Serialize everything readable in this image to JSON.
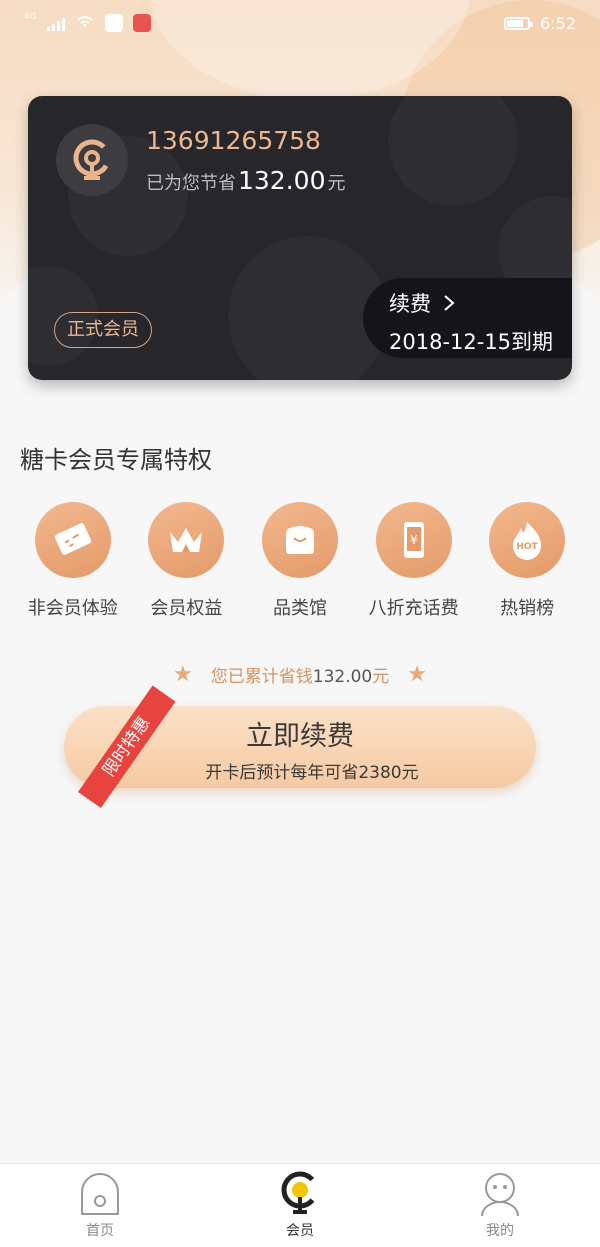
{
  "status_bar": {
    "network": "4G",
    "time": "6:52",
    "notification_icons": [
      "sina-weibo-icon",
      "red-app-icon"
    ]
  },
  "member_card": {
    "phone": "13691265758",
    "saved_prefix": "已为您节省",
    "saved_amount": "132.00",
    "saved_unit": "元",
    "member_badge": "正式会员",
    "renew_label": "续费",
    "expiry": "2018-12-15到期"
  },
  "privileges": {
    "title": "糖卡会员专属特权",
    "items": [
      {
        "label": "非会员体验",
        "icon": "ticket-icon"
      },
      {
        "label": "会员权益",
        "icon": "crown-icon"
      },
      {
        "label": "品类馆",
        "icon": "shopping-bag-icon"
      },
      {
        "label": "八折充话费",
        "icon": "phone-recharge-icon"
      },
      {
        "label": "热销榜",
        "icon": "hot-flame-icon"
      }
    ]
  },
  "accumulated": {
    "text": "您已累计省钱",
    "amount": "132.00",
    "unit": "元"
  },
  "renew_button": {
    "title": "立即续费",
    "subtitle": "开卡后预计每年可省2380元",
    "ribbon": "限时特惠"
  },
  "bottom_nav": {
    "items": [
      {
        "label": "首页",
        "icon": "home-icon",
        "active": false
      },
      {
        "label": "会员",
        "icon": "member-icon",
        "active": true
      },
      {
        "label": "我的",
        "icon": "profile-icon",
        "active": false
      }
    ]
  },
  "colors": {
    "accent": "#e49a6a",
    "card_bg": "#27262a",
    "gold_text": "#eab78f",
    "ribbon_red": "#e7433f"
  }
}
